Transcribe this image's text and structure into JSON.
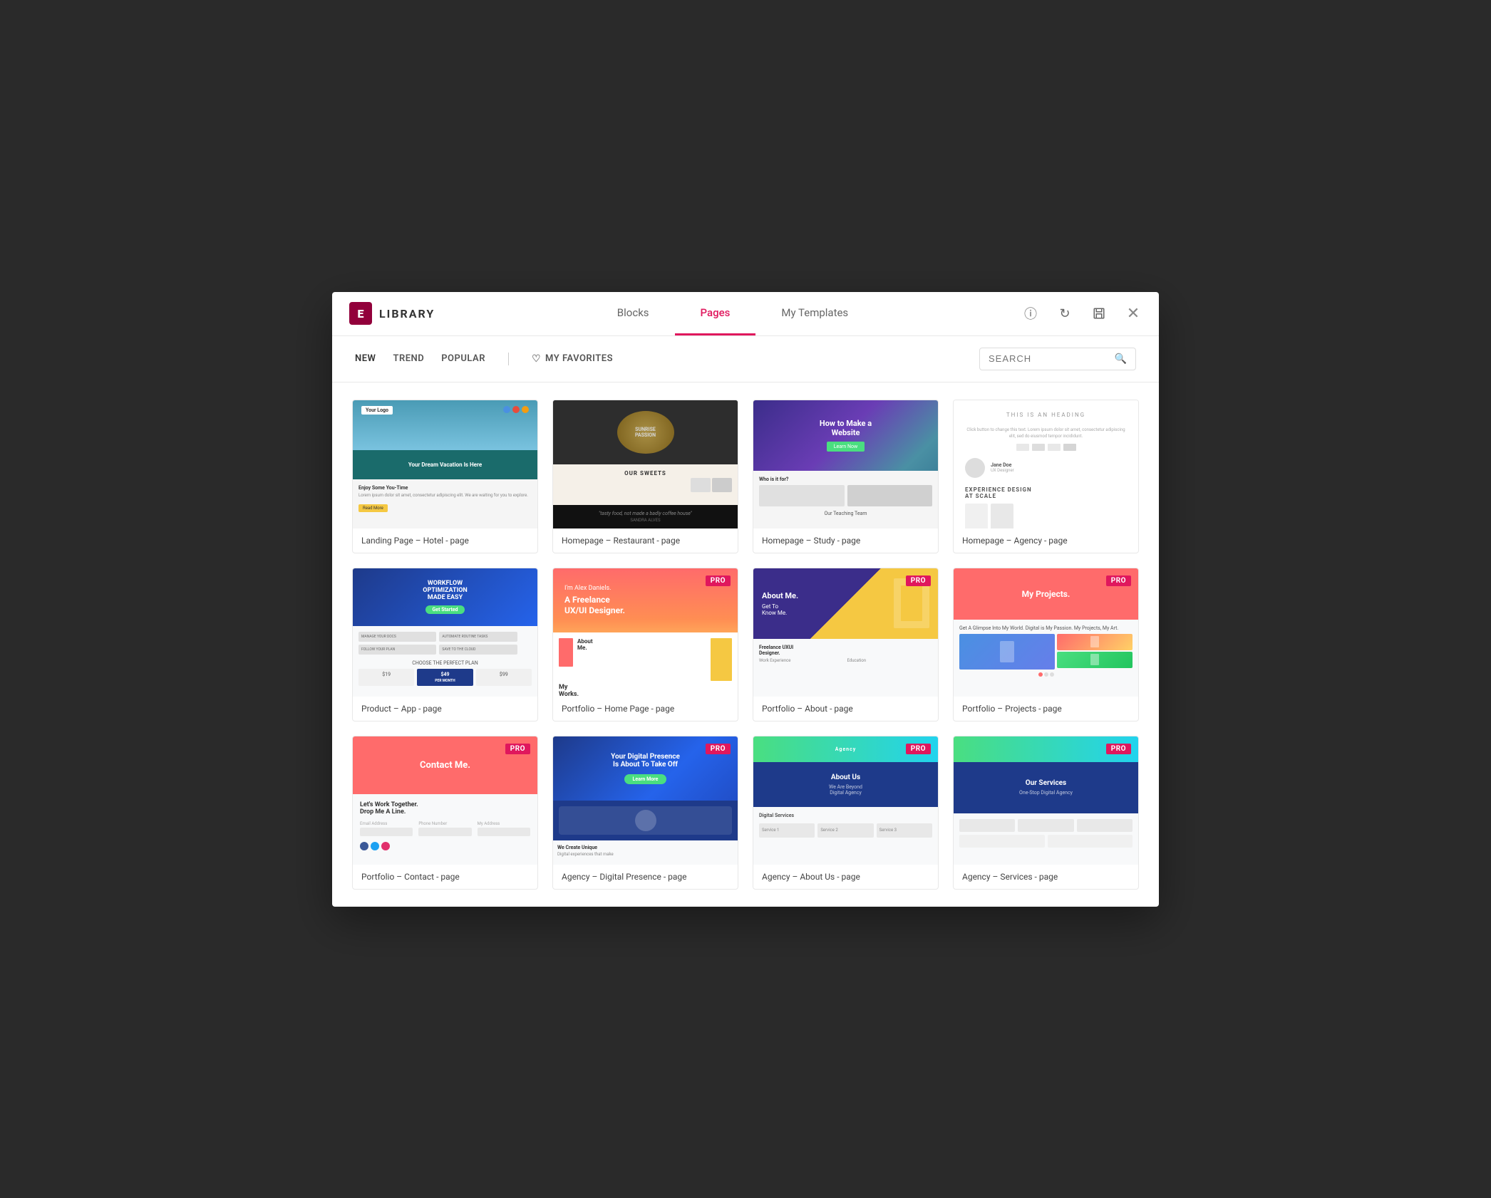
{
  "header": {
    "brand": {
      "icon": "E",
      "text": "LIBRARY"
    },
    "tabs": [
      {
        "id": "blocks",
        "label": "Blocks",
        "active": false
      },
      {
        "id": "pages",
        "label": "Pages",
        "active": true
      },
      {
        "id": "my-templates",
        "label": "My Templates",
        "active": false
      }
    ],
    "actions": {
      "info": "ℹ",
      "refresh": "↻",
      "save": "💾",
      "close": "✕"
    }
  },
  "filters": {
    "tabs": [
      {
        "id": "new",
        "label": "NEW",
        "active": true
      },
      {
        "id": "trend",
        "label": "TREND",
        "active": false
      },
      {
        "id": "popular",
        "label": "POPULAR",
        "active": false
      }
    ],
    "favorites": {
      "label": "MY FAVORITES",
      "icon": "♡"
    },
    "search": {
      "placeholder": "SEARCH"
    }
  },
  "templates": [
    {
      "id": "hotel",
      "label": "Landing Page – Hotel - page",
      "pro": false,
      "theme": "hotel"
    },
    {
      "id": "restaurant",
      "label": "Homepage – Restaurant - page",
      "pro": false,
      "theme": "restaurant"
    },
    {
      "id": "study",
      "label": "Homepage – Study - page",
      "pro": false,
      "theme": "study"
    },
    {
      "id": "agency",
      "label": "Homepage – Agency - page",
      "pro": false,
      "theme": "agency"
    },
    {
      "id": "app",
      "label": "Product – App - page",
      "pro": false,
      "theme": "app"
    },
    {
      "id": "portfolio-home",
      "label": "Portfolio – Home Page - page",
      "pro": true,
      "theme": "portfolio-home"
    },
    {
      "id": "portfolio-about",
      "label": "Portfolio – About - page",
      "pro": true,
      "theme": "portfolio-about"
    },
    {
      "id": "portfolio-projects",
      "label": "Portfolio – Projects - page",
      "pro": true,
      "theme": "portfolio-projects"
    },
    {
      "id": "contact",
      "label": "Portfolio – Contact - page",
      "pro": true,
      "theme": "contact"
    },
    {
      "id": "digital",
      "label": "Agency – Digital Presence - page",
      "pro": true,
      "theme": "digital"
    },
    {
      "id": "about-us",
      "label": "Agency – About Us - page",
      "pro": true,
      "theme": "about-us"
    },
    {
      "id": "services",
      "label": "Agency – Services - page",
      "pro": true,
      "theme": "services"
    }
  ],
  "pro_label": "PRO",
  "colors": {
    "accent": "#e0175d",
    "brand_bg": "#92003b",
    "pro_bg": "#e0175d"
  }
}
